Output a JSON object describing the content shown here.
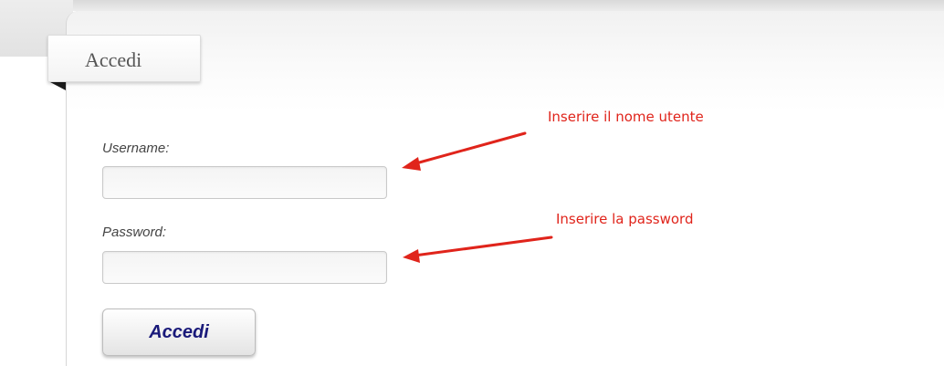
{
  "tab": {
    "label": "Accedi"
  },
  "form": {
    "username_label": "Username:",
    "username_value": "",
    "password_label": "Password:",
    "password_value": "",
    "submit_label": "Accedi"
  },
  "annotations": {
    "username_hint": "Inserire il nome utente",
    "password_hint": "Inserire la password",
    "color": "#e0241b"
  },
  "icons": {
    "username_arrow": "arrow-left-icon",
    "password_arrow": "arrow-left-icon"
  }
}
